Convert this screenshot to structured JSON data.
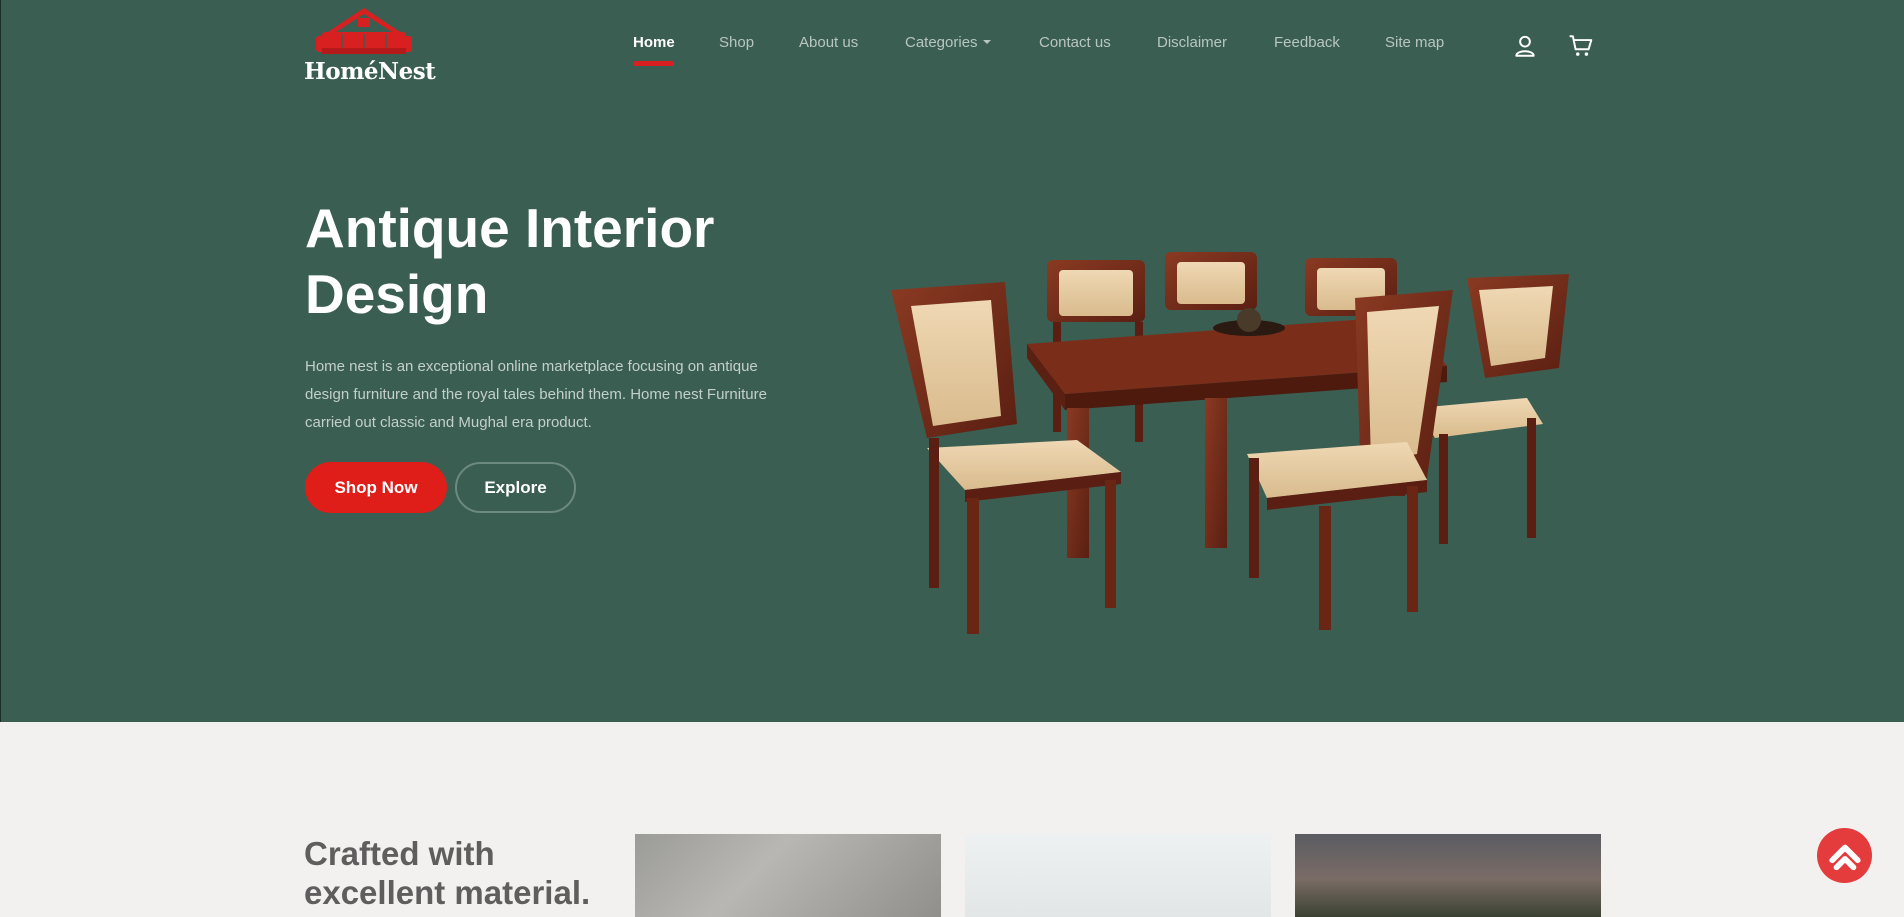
{
  "brand": {
    "name": "HoméNest",
    "accent": "#df1e1a",
    "hero_bg": "#3b5e52"
  },
  "nav": {
    "items": [
      {
        "label": "Home",
        "active": true
      },
      {
        "label": "Shop"
      },
      {
        "label": "About us"
      },
      {
        "label": "Categories",
        "has_dropdown": true
      },
      {
        "label": "Contact us"
      },
      {
        "label": "Disclaimer"
      },
      {
        "label": "Feedback"
      },
      {
        "label": "Site map"
      }
    ],
    "icons": [
      "user-icon",
      "cart-icon"
    ]
  },
  "hero": {
    "title": "Antique Interior Design",
    "description": "Home nest is an exceptional online marketplace focusing on antique design furniture and the royal tales behind them. Home nest Furniture carried out classic and Mughal era product.",
    "primary_button": "Shop Now",
    "secondary_button": "Explore"
  },
  "section2": {
    "heading": "Crafted with excellent material."
  },
  "scroll_top_icon": "chevron-up-icon"
}
